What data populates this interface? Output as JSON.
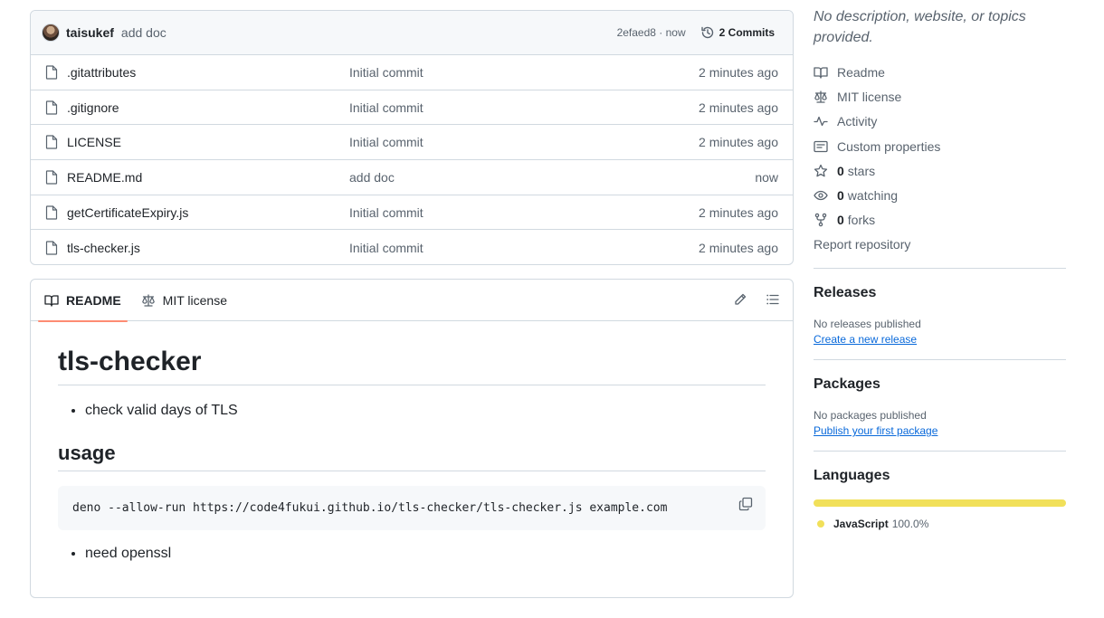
{
  "latest_commit": {
    "author": "taisukef",
    "message": "add doc",
    "meta": "2efaed8 · now",
    "commits_label": "2 Commits"
  },
  "files": [
    {
      "name": ".gitattributes",
      "commit": "Initial commit",
      "time": "2 minutes ago"
    },
    {
      "name": ".gitignore",
      "commit": "Initial commit",
      "time": "2 minutes ago"
    },
    {
      "name": "LICENSE",
      "commit": "Initial commit",
      "time": "2 minutes ago"
    },
    {
      "name": "README.md",
      "commit": "add doc",
      "time": "now"
    },
    {
      "name": "getCertificateExpiry.js",
      "commit": "Initial commit",
      "time": "2 minutes ago"
    },
    {
      "name": "tls-checker.js",
      "commit": "Initial commit",
      "time": "2 minutes ago"
    }
  ],
  "readme_tabs": {
    "readme": "README",
    "license": "MIT license"
  },
  "readme": {
    "title": "tls-checker",
    "bullet1": "check valid days of TLS",
    "usage_heading": "usage",
    "code": "deno --allow-run https://code4fukui.github.io/tls-checker/tls-checker.js example.com",
    "bullet2": "need openssl"
  },
  "sidebar": {
    "description": "No description, website, or topics provided.",
    "readme": "Readme",
    "license": "MIT license",
    "activity": "Activity",
    "custom_properties": "Custom properties",
    "stars_count": "0",
    "stars_label": "stars",
    "watching_count": "0",
    "watching_label": "watching",
    "forks_count": "0",
    "forks_label": "forks",
    "report": "Report repository",
    "releases_heading": "Releases",
    "releases_text": "No releases published",
    "releases_link": "Create a new release",
    "packages_heading": "Packages",
    "packages_text": "No packages published",
    "packages_link": "Publish your first package",
    "languages_heading": "Languages",
    "language_name": "JavaScript",
    "language_pct": "100.0%"
  },
  "colors": {
    "javascript": "#f1e05a",
    "tab_underline": "#fd8c73",
    "link": "#0969da"
  }
}
